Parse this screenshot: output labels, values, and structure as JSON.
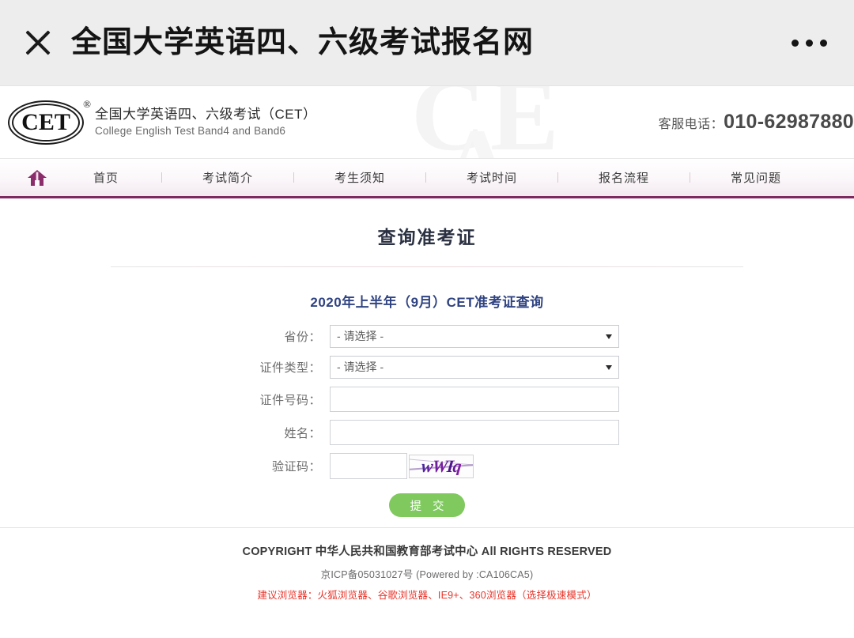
{
  "topbar": {
    "close_icon": "close-icon",
    "title": "全国大学英语四、六级考试报名网",
    "more_icon": "more-dots-icon"
  },
  "header": {
    "logo_mark": "CET",
    "logo_registered": "®",
    "logo_title_cn": "全国大学英语四、六级考试（CET）",
    "logo_title_en": "College English Test Band4 and Band6",
    "watermark_1": "CE",
    "watermark_2": "A",
    "hotline_label": "客服电话：",
    "hotline_number": "010-62987880"
  },
  "nav": {
    "home_icon": "home-icon",
    "items": [
      {
        "label": "首页"
      },
      {
        "label": "考试简介"
      },
      {
        "label": "考生须知"
      },
      {
        "label": "考试时间"
      },
      {
        "label": "报名流程"
      },
      {
        "label": "常见问题"
      }
    ],
    "accent_color": "#7e2a61"
  },
  "main": {
    "page_title": "查询准考证",
    "form_subtitle": "2020年上半年（9月）CET准考证查询",
    "fields": {
      "province": {
        "label": "省份：",
        "value": "- 请选择 -",
        "options": [
          "- 请选择 -"
        ]
      },
      "id_type": {
        "label": "证件类型：",
        "value": "- 请选择 -",
        "options": [
          "- 请选择 -"
        ]
      },
      "id_number": {
        "label": "证件号码：",
        "value": "",
        "placeholder": ""
      },
      "name": {
        "label": "姓名：",
        "value": "",
        "placeholder": ""
      },
      "captcha": {
        "label": "验证码：",
        "value": "",
        "placeholder": "",
        "image_text": "wWIq",
        "image_name": "captcha-image"
      }
    },
    "submit_label": "提 交",
    "submit_color": "#7fc95f"
  },
  "footer": {
    "copyright": "COPYRIGHT 中华人民共和国教育部考试中心 All RIGHTS RESERVED",
    "icp": "京ICP备05031027号 (Powered by :CA106CA5)",
    "browser_tip": "建议浏览器：火狐浏览器、谷歌浏览器、IE9+、360浏览器（选择极速模式）",
    "tip_color": "#e8342a"
  }
}
